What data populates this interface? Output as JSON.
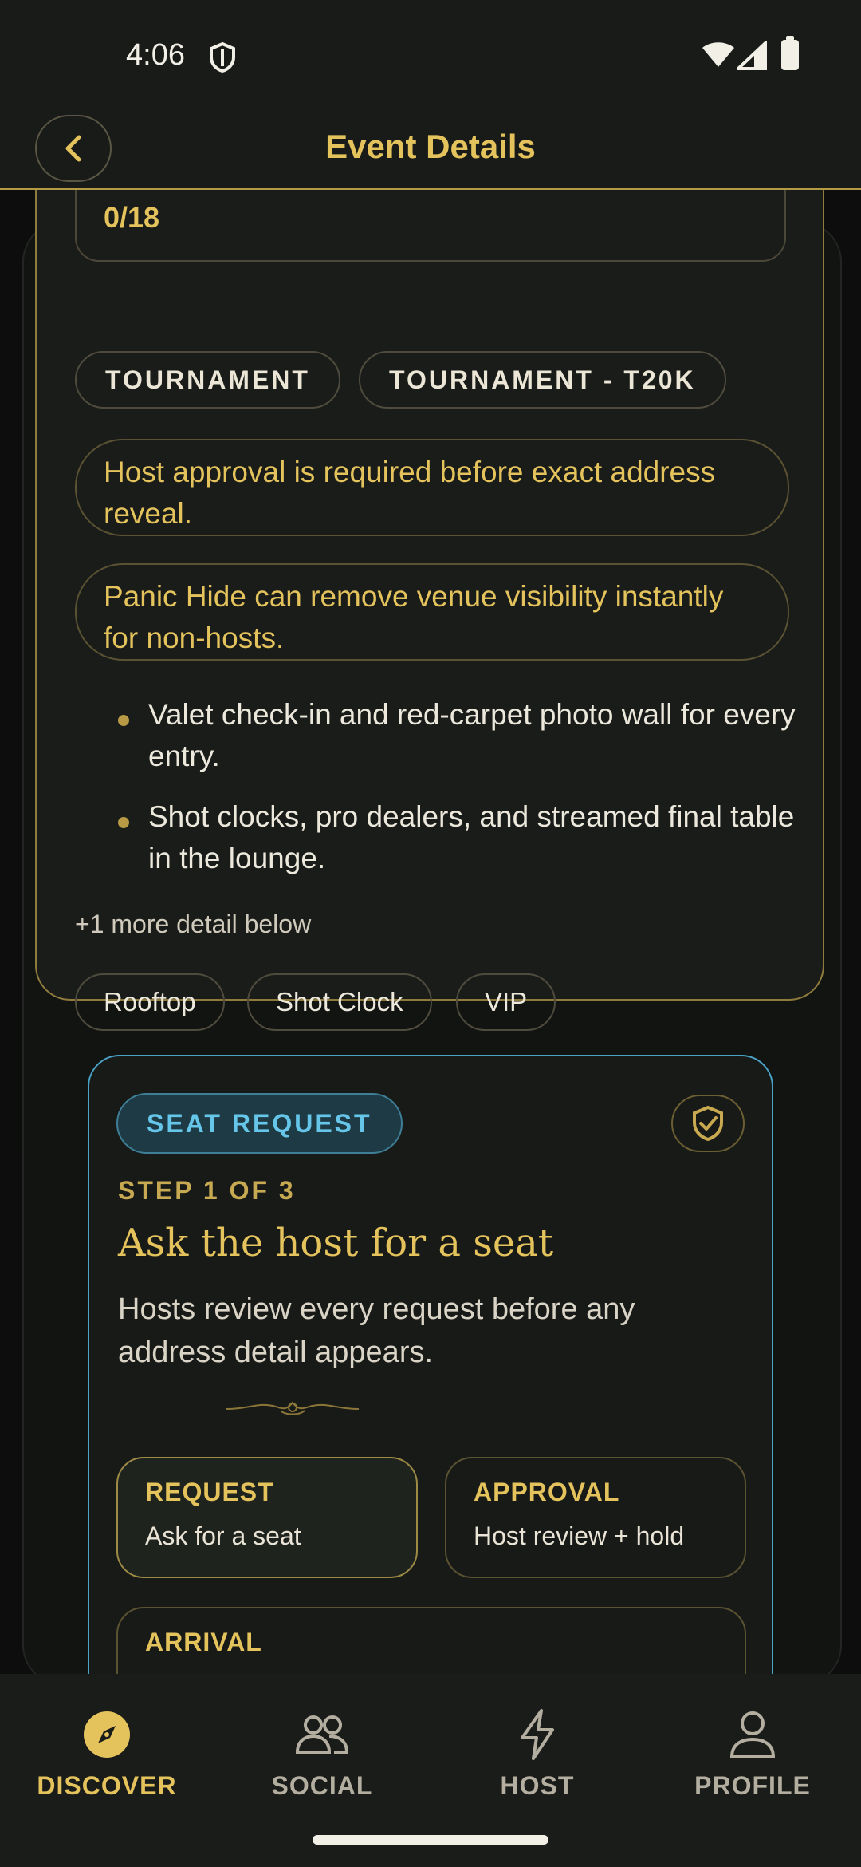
{
  "status_bar": {
    "time": "4:06"
  },
  "app_bar": {
    "title": "Event Details"
  },
  "event": {
    "seats": "0/18",
    "tags": [
      "TOURNAMENT",
      "TOURNAMENT - T20K"
    ],
    "notices": [
      "Host approval is required before exact address reveal.",
      "Panic Hide can remove venue visibility instantly for non-hosts."
    ],
    "highlights": [
      "Valet check-in and red-carpet photo wall for every entry.",
      "Shot clocks, pro dealers, and streamed final table in the lounge."
    ],
    "more_details": "+1 more detail below",
    "chips": [
      "Rooftop",
      "Shot Clock",
      "VIP"
    ]
  },
  "seat_request": {
    "badge": "SEAT REQUEST",
    "step": "STEP 1 OF 3",
    "title": "Ask the host for a seat",
    "description": "Hosts review every request before any address detail appears.",
    "steps": [
      {
        "label": "REQUEST",
        "sub": "Ask for a seat"
      },
      {
        "label": "APPROVAL",
        "sub": "Host review + hold"
      },
      {
        "label": "ARRIVAL",
        "sub": ""
      }
    ]
  },
  "bottom_nav": [
    {
      "label": "DISCOVER",
      "icon": "compass-icon",
      "active": true
    },
    {
      "label": "SOCIAL",
      "icon": "people-icon",
      "active": false
    },
    {
      "label": "HOST",
      "icon": "lightning-icon",
      "active": false
    },
    {
      "label": "PROFILE",
      "icon": "person-icon",
      "active": false
    }
  ],
  "colors": {
    "accent": "#e4c35c",
    "info": "#66c6ea",
    "background": "#0b0c0b"
  }
}
